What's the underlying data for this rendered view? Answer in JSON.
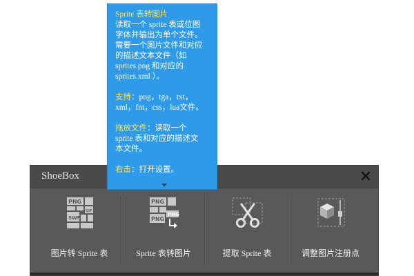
{
  "window": {
    "title": "ShoeBox"
  },
  "tools": [
    {
      "label": "图片转 Sprite 表",
      "icon": "images-to-sprite-icon"
    },
    {
      "label": "Sprite 表转图片",
      "icon": "sprite-to-images-icon"
    },
    {
      "label": "提取 Sprite 表",
      "icon": "extract-sprite-icon"
    },
    {
      "label": "调整图片注册点",
      "icon": "registration-point-icon"
    }
  ],
  "tooltip": {
    "title": "Sprite 表转图片",
    "lines": [
      "读取一个 sprite 表或位图",
      "字体并输出为单个文件。",
      "需要一个图片文件和对应",
      "的描述文本文件（如",
      "sprites.png 和对应的",
      "sprites.xml ）。"
    ],
    "support_label": "支持",
    "support_lines": [
      "：png，tga，txt，",
      "xml，fnt，css，lua文件。"
    ],
    "drag_label": "拖放文件",
    "drag_lines": [
      "：读取一个",
      "sprite 表和对应的描述文",
      "本文件。"
    ],
    "rightclick_label": "右击",
    "rightclick_text": "：打开设置。"
  },
  "colors": {
    "tooltip_bg": "#2e9ae8",
    "window_bg": "#595959",
    "titlebar_bg": "#4a4a4a",
    "highlight": "#ffe45c",
    "icon_fill": "#c8c8c8"
  }
}
